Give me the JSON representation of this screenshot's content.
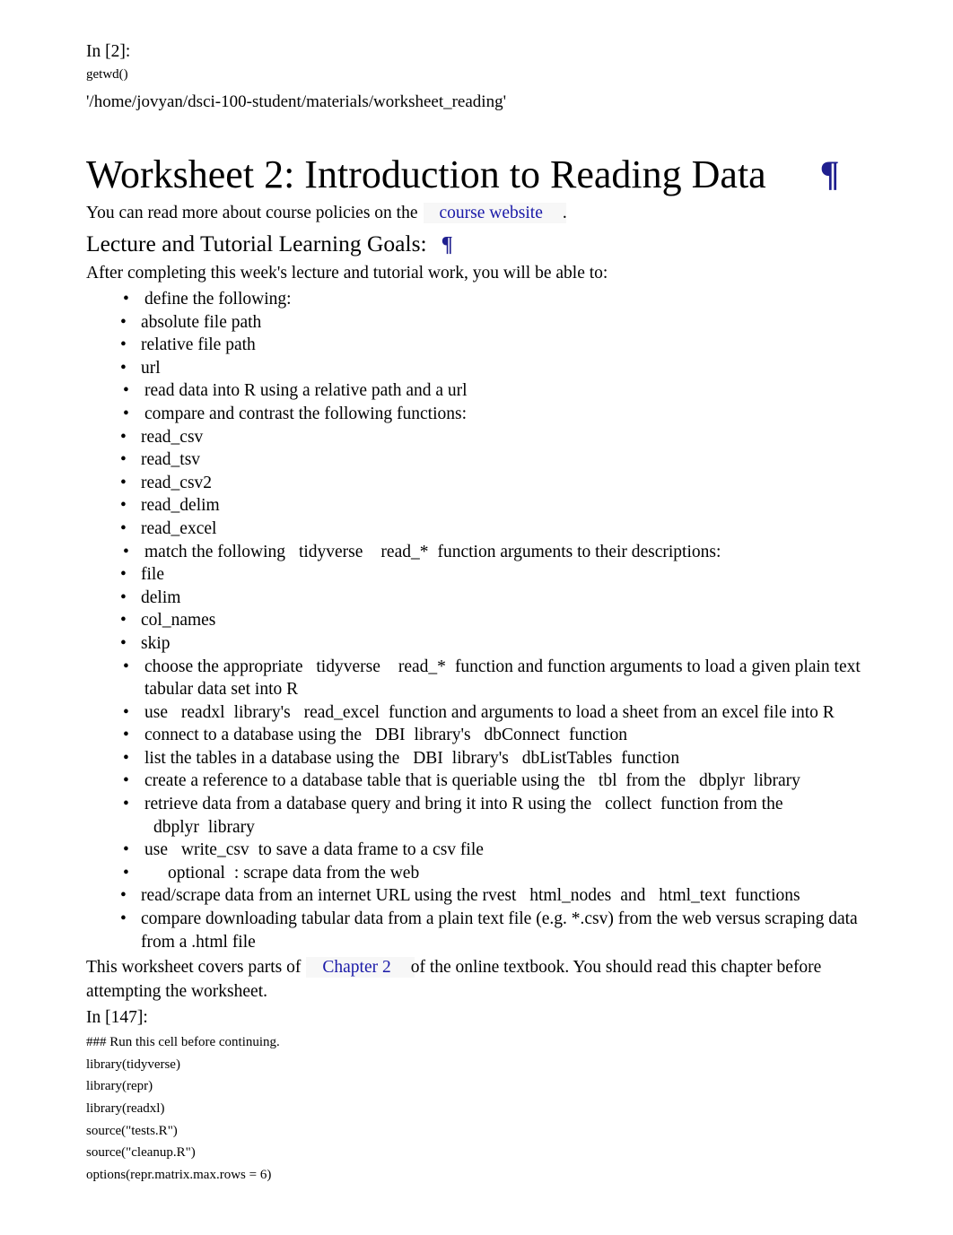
{
  "cell1": {
    "prompt": "In [2]:",
    "code": [
      "getwd()"
    ],
    "output": "'/home/jovyan/dsci-100-student/materials/worksheet_reading'"
  },
  "title": "Worksheet 2: Introduction to Reading Data",
  "pilcrow_glyph": "¶",
  "bullet_glyph": "•",
  "intro": {
    "before_link": "You can read more about course policies on the",
    "link_text": "course website",
    "after_link": "."
  },
  "subtitle": "Lecture and Tutorial Learning Goals:",
  "goals_lead": "After completing this week's lecture and tutorial work, you will be able to:",
  "goals": [
    {
      "text": "define the following:",
      "children": [
        {
          "text": "absolute file path"
        },
        {
          "text": "relative file path"
        },
        {
          "text": "url"
        }
      ]
    },
    {
      "text": "read data into R using a relative path and a url"
    },
    {
      "text": "compare and contrast the following functions:",
      "children": [
        {
          "code": "read_csv"
        },
        {
          "code": "read_tsv"
        },
        {
          "code": "read_csv2"
        },
        {
          "code": "read_delim"
        },
        {
          "code": "read_excel"
        }
      ]
    },
    {
      "parts": [
        {
          "t": "text",
          "v": "match the following"
        },
        {
          "t": "code",
          "v": "tidyverse"
        },
        {
          "t": "code",
          "v": "read_*"
        },
        {
          "t": "text",
          "v": "function arguments to their descriptions:"
        }
      ],
      "children": [
        {
          "code": "file"
        },
        {
          "code": "delim"
        },
        {
          "code": "col_names"
        },
        {
          "code": "skip"
        }
      ]
    },
    {
      "parts": [
        {
          "t": "text",
          "v": "choose the appropriate"
        },
        {
          "t": "code",
          "v": "tidyverse"
        },
        {
          "t": "code",
          "v": "read_*"
        },
        {
          "t": "text",
          "v": "function and function arguments to load a given plain text tabular data set into R"
        }
      ]
    },
    {
      "parts": [
        {
          "t": "text",
          "v": "use"
        },
        {
          "t": "code",
          "v": "readxl"
        },
        {
          "t": "text",
          "v": "library's"
        },
        {
          "t": "code",
          "v": "read_excel"
        },
        {
          "t": "text",
          "v": "function and arguments to load a sheet from an excel file into R"
        }
      ]
    },
    {
      "parts": [
        {
          "t": "text",
          "v": "connect to a database using the"
        },
        {
          "t": "code",
          "v": "DBI"
        },
        {
          "t": "text",
          "v": "library's"
        },
        {
          "t": "code",
          "v": "dbConnect"
        },
        {
          "t": "text",
          "v": "function"
        }
      ]
    },
    {
      "parts": [
        {
          "t": "text",
          "v": "list the tables in a database using the"
        },
        {
          "t": "code",
          "v": "DBI"
        },
        {
          "t": "text",
          "v": "library's"
        },
        {
          "t": "code",
          "v": "dbListTables"
        },
        {
          "t": "text",
          "v": "function"
        }
      ]
    },
    {
      "parts": [
        {
          "t": "text",
          "v": "create a reference to a database table that is queriable using the"
        },
        {
          "t": "code",
          "v": "tbl"
        },
        {
          "t": "text",
          "v": "from the"
        },
        {
          "t": "code",
          "v": "dbplyr"
        },
        {
          "t": "text",
          "v": "library"
        }
      ]
    },
    {
      "parts": [
        {
          "t": "text",
          "v": "retrieve data from a database query and bring it into R using the"
        },
        {
          "t": "code",
          "v": "collect"
        },
        {
          "t": "text",
          "v": "function from the"
        },
        {
          "t": "code",
          "v": "dbplyr"
        },
        {
          "t": "text",
          "v": "library"
        }
      ]
    },
    {
      "parts": [
        {
          "t": "text",
          "v": "use"
        },
        {
          "t": "code",
          "v": "write_csv"
        },
        {
          "t": "text",
          "v": "to save a data frame to a csv file"
        }
      ]
    },
    {
      "parts": [
        {
          "t": "code",
          "v": "optional"
        },
        {
          "t": "text",
          "v": ": scrape data from the web"
        }
      ],
      "children": [
        {
          "parts": [
            {
              "t": "text",
              "v": "read/scrape data from an internet URL using the rvest"
            },
            {
              "t": "code",
              "v": "html_nodes"
            },
            {
              "t": "text",
              "v": "and"
            },
            {
              "t": "code",
              "v": "html_text"
            },
            {
              "t": "text",
              "v": "functions"
            }
          ]
        },
        {
          "text": "compare downloading tabular data from a plain text file (e.g. *.csv) from the web versus scraping data from a .html file"
        }
      ]
    }
  ],
  "closing": {
    "before_link": "This worksheet covers parts of",
    "link_text": "Chapter 2",
    "after_link": "of the online textbook. You should read this chapter before attempting the worksheet."
  },
  "cell2": {
    "prompt": "In [147]:",
    "code": [
      "### Run this cell before continuing.",
      "library(tidyverse)",
      "library(repr)",
      "library(readxl)",
      "source(\"tests.R\")",
      "source(\"cleanup.R\")",
      "options(repr.matrix.max.rows = 6)"
    ]
  },
  "colors": {
    "link": "#1a1aa8",
    "pilcrow": "#1f1f8f",
    "text": "#000000",
    "link_highlight": "#f7f7f7"
  }
}
